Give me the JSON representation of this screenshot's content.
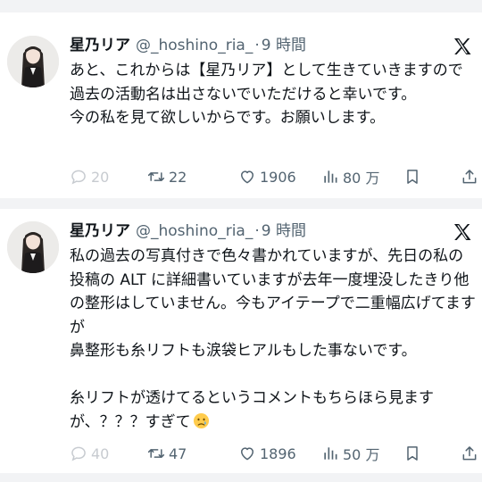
{
  "tweets": [
    {
      "name": "星乃リア",
      "handle": "@_hoshino_ria_",
      "sep": "·",
      "time": "9 時間",
      "text": "あと、これからは【星乃リア】として生きていきますので過去の活動名は出さないでいただけると幸いです。\n今の私を見て欲しいからです。お願いします。",
      "reply_count": "20",
      "retweet_count": "22",
      "like_count": "1906",
      "view_count": "80 万"
    },
    {
      "name": "星乃リア",
      "handle": "@_hoshino_ria_",
      "sep": "·",
      "time": "9 時間",
      "text": "私の過去の写真付きで色々書かれていますが、先日の私の投稿の ALT に詳細書いていますが去年一度埋没したきり他の整形はしていません。今もアイテープで二重幅広げてますが\n鼻整形も糸リフトも涙袋ヒアルもした事ないです。\n\n糸リフトが透けてるというコメントもちらほら見ますが、？？？すぎて",
      "emoji": "crying-face",
      "reply_count": "40",
      "retweet_count": "47",
      "like_count": "1896",
      "view_count": "50 万"
    }
  ],
  "icons": [
    "x-logo-icon",
    "reply-icon",
    "retweet-icon",
    "like-icon",
    "views-icon",
    "bookmark-icon",
    "share-icon"
  ],
  "colors": {
    "text": "#0f1419",
    "secondary": "#536471",
    "separator": "#f2f3f5"
  }
}
